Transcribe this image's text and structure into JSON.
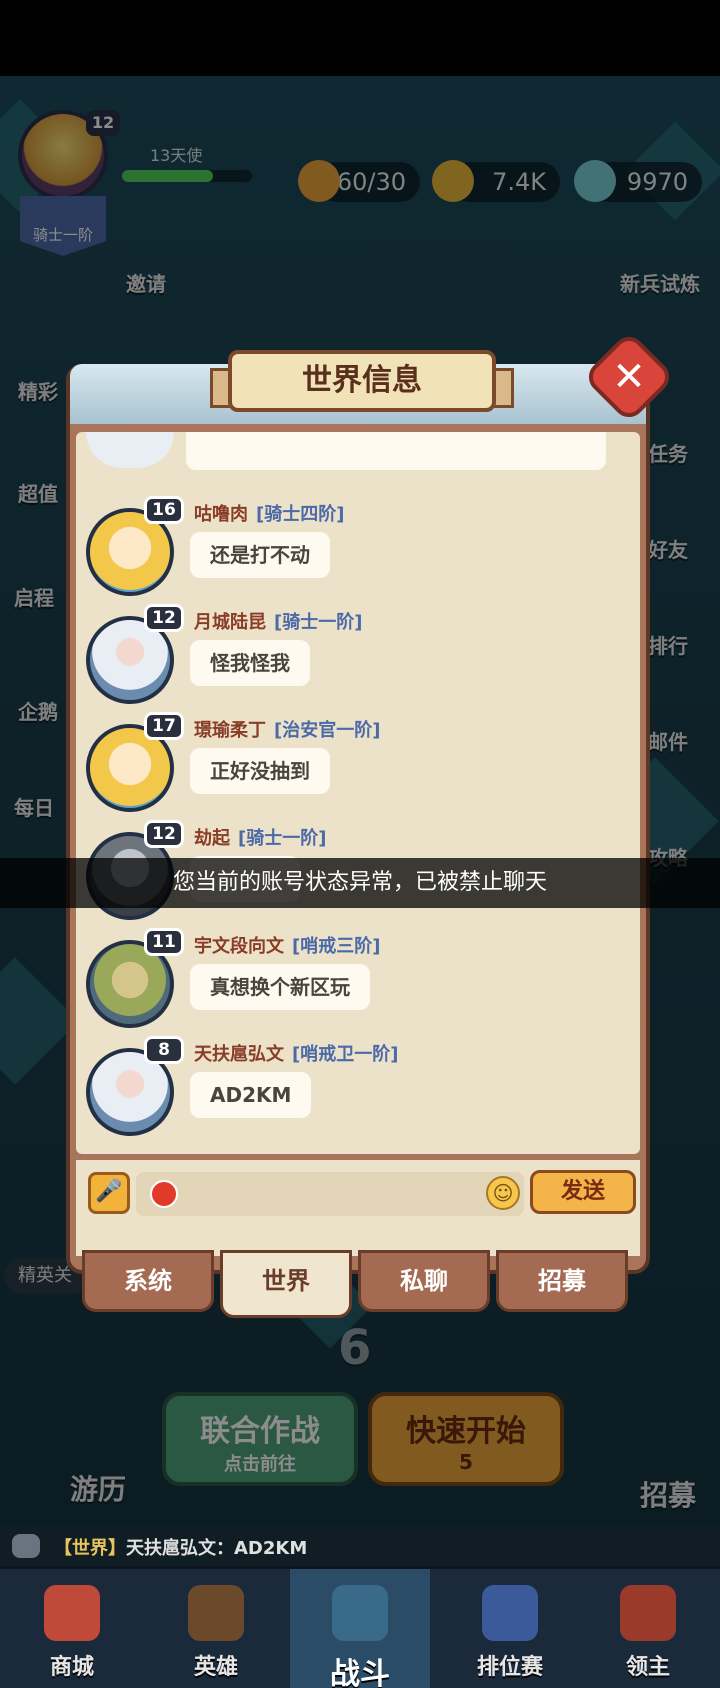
{
  "hud": {
    "level": "12",
    "player_name": "13天使",
    "rank_badge": "骑士一阶",
    "xp_fraction": 0.7,
    "stamina": "60/30",
    "gold": "7.4K",
    "gems": "9970"
  },
  "side_left": [
    "邀请",
    "精彩",
    "超值",
    "启程",
    "企鹅",
    "每日"
  ],
  "side_right": [
    "新兵试炼",
    "任务",
    "好友",
    "排行",
    "邮件",
    "攻略"
  ],
  "modal": {
    "title": "世界信息",
    "close_label": "✕",
    "messages": [
      {
        "level": "16",
        "name": "咕噜肉",
        "rank": "[骑士四阶]",
        "text": "还是打不动",
        "avatar": "gold"
      },
      {
        "level": "12",
        "name": "月城陆昆",
        "rank": "[骑士一阶]",
        "text": "怪我怪我",
        "avatar": "wizard"
      },
      {
        "level": "17",
        "name": "璟瑜柔丁",
        "rank": "[治安官一阶]",
        "text": "正好没抽到",
        "avatar": "gold"
      },
      {
        "level": "12",
        "name": "劫起",
        "rank": "[骑士一阶]",
        "text": "",
        "avatar": "dark"
      },
      {
        "level": "11",
        "name": "宇文段向文",
        "rank": "[哨戒三阶]",
        "text": "真想换个新区玩",
        "avatar": "lizard"
      },
      {
        "level": "8",
        "name": "天扶扈弘文",
        "rank": "[哨戒卫一阶]",
        "text": "AD2KM",
        "avatar": "wizard"
      }
    ],
    "send_label": "发送",
    "tabs": [
      {
        "label": "系统",
        "active": false
      },
      {
        "label": "世界",
        "active": true
      },
      {
        "label": "私聊",
        "active": false
      },
      {
        "label": "招募",
        "active": false
      }
    ]
  },
  "toast": "您当前的账号状态异常，已被禁止聊天",
  "bottom_area": {
    "small_tag": "精英关",
    "union_battle": "联合作战",
    "union_sub": "点击前往",
    "quick_start": "快速开始",
    "quick_cost": "5",
    "travel": "游历",
    "recruit": "招募",
    "stage_number": "6"
  },
  "ticker": {
    "channel": "【世界】",
    "text": "天扶扈弘文：AD2KM"
  },
  "nav": [
    "商城",
    "英雄",
    "战斗",
    "排位赛",
    "领主"
  ],
  "colors": {
    "accent_red": "#d9453a",
    "send_orange": "#f3b44a",
    "name_brown": "#8a3d26",
    "rank_blue": "#4b6aa8"
  }
}
